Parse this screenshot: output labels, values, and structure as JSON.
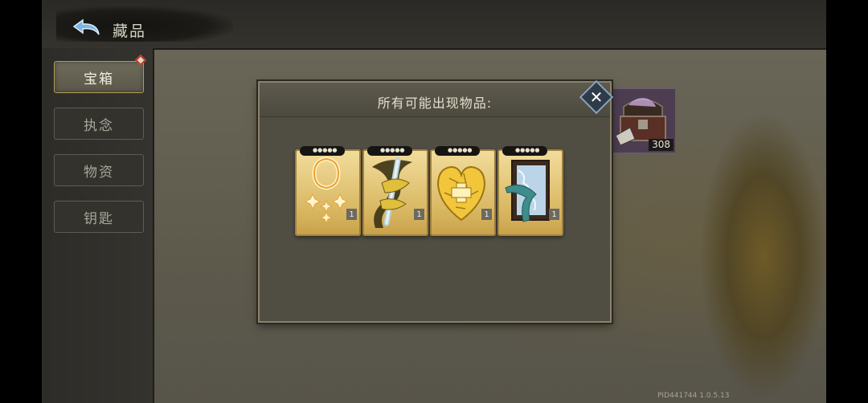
{
  "header": {
    "title": "藏品"
  },
  "sidebar": {
    "items": [
      {
        "label": "宝箱",
        "active": true
      },
      {
        "label": "执念",
        "active": false
      },
      {
        "label": "物资",
        "active": false
      },
      {
        "label": "钥匙",
        "active": false
      }
    ]
  },
  "dialog": {
    "title": "所有可能出现物品:",
    "items": [
      {
        "icon": "holy-ring-icon",
        "count": "1"
      },
      {
        "icon": "wrapped-staff-icon",
        "count": "1"
      },
      {
        "icon": "golden-heart-icon",
        "count": "1"
      },
      {
        "icon": "scroll-ribbon-icon",
        "count": "1"
      }
    ]
  },
  "chest": {
    "count": "308",
    "icon": "treasure-chest-icon"
  },
  "footer": {
    "pid": "PID441744  1.0.5.13"
  },
  "colors": {
    "accent": "#b49c55",
    "card_gold": "#e2c476",
    "close_blue": "#8aa2bd"
  }
}
